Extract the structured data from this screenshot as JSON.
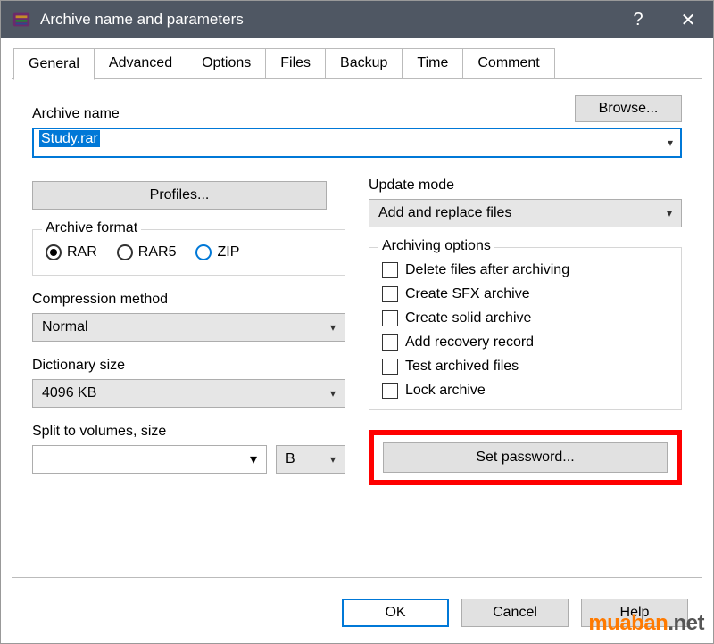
{
  "window": {
    "title": "Archive name and parameters",
    "help_glyph": "?",
    "close_glyph": "✕"
  },
  "tabs": [
    "General",
    "Advanced",
    "Options",
    "Files",
    "Backup",
    "Time",
    "Comment"
  ],
  "active_tab_index": 0,
  "general": {
    "archive_name_label": "Archive name",
    "browse_label": "Browse...",
    "archive_name_value": "Study.rar",
    "archive_name_selected": true,
    "profiles_label": "Profiles...",
    "format_legend": "Archive format",
    "formats": [
      {
        "label": "RAR",
        "checked": true
      },
      {
        "label": "RAR5",
        "checked": false
      },
      {
        "label": "ZIP",
        "checked": false,
        "blue": true
      }
    ],
    "compression_label": "Compression method",
    "compression_value": "Normal",
    "dictionary_label": "Dictionary size",
    "dictionary_value": "4096 KB",
    "split_label": "Split to volumes, size",
    "split_value": "",
    "split_unit": "B",
    "update_label": "Update mode",
    "update_value": "Add and replace files",
    "options_legend": "Archiving options",
    "options": [
      {
        "label": "Delete files after archiving",
        "checked": false
      },
      {
        "label": "Create SFX archive",
        "checked": false
      },
      {
        "label": "Create solid archive",
        "checked": false
      },
      {
        "label": "Add recovery record",
        "checked": false
      },
      {
        "label": "Test archived files",
        "checked": false
      },
      {
        "label": "Lock archive",
        "checked": false
      }
    ],
    "set_password_label": "Set password..."
  },
  "footer": {
    "ok": "OK",
    "cancel": "Cancel",
    "help": "Help"
  },
  "watermark": {
    "part1": "muaban",
    "part2": ".net"
  },
  "highlight": {
    "set_password_border": "#ff0000"
  }
}
